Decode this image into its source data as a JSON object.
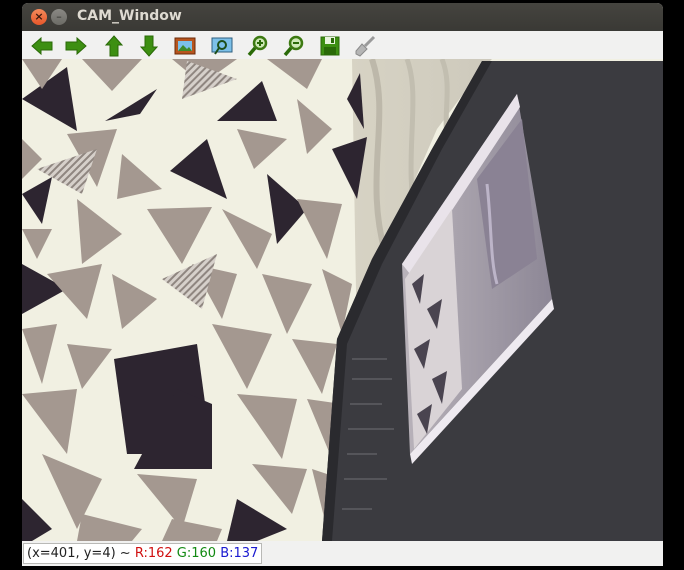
{
  "window": {
    "title": "CAM_Window",
    "close_label": "×",
    "minimize_label": "–"
  },
  "toolbar": {
    "tools": [
      {
        "name": "pan-left-icon"
      },
      {
        "name": "pan-right-icon"
      },
      {
        "name": "pan-up-icon"
      },
      {
        "name": "pan-down-icon"
      },
      {
        "name": "zoom-image-icon"
      },
      {
        "name": "zoom-fit-icon"
      },
      {
        "name": "zoom-in-icon"
      },
      {
        "name": "zoom-out-icon"
      },
      {
        "name": "save-icon"
      },
      {
        "name": "properties-brush-icon"
      }
    ]
  },
  "status": {
    "coords": "(x=401, y=4) ~ ",
    "r": "R:162",
    "g": "G:160",
    "b": "B:137"
  },
  "colors": {
    "arrow_green": "#3d8f12",
    "title_bar": "#3c3b37",
    "pattern_dark": "#2d2530",
    "pattern_taupe": "#a49890",
    "fabric_bg": "#f1f0e2",
    "monitor": "#3b3b40"
  }
}
